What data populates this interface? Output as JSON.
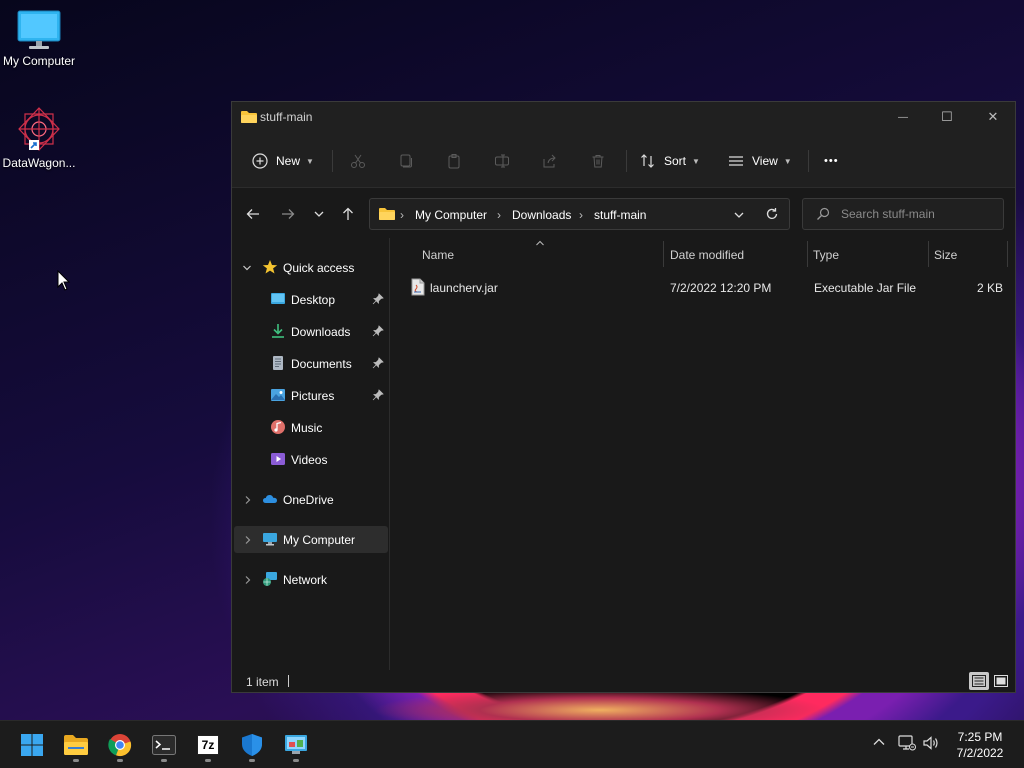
{
  "desktop": {
    "icons": [
      {
        "label": "My Computer"
      },
      {
        "label": "DataWagon..."
      }
    ]
  },
  "window": {
    "title": "stuff-main",
    "controls": {
      "minimize": "—",
      "maximize": "☐",
      "close": "✕"
    }
  },
  "toolbar": {
    "new_label": "New",
    "sort_label": "Sort",
    "view_label": "View",
    "more_label": "•••"
  },
  "address": {
    "crumbs": [
      "My Computer",
      "Downloads",
      "stuff-main"
    ],
    "search_placeholder": "Search stuff-main"
  },
  "sidebar": {
    "quick_access": "Quick access",
    "items": [
      {
        "label": "Desktop",
        "pinned": true
      },
      {
        "label": "Downloads",
        "pinned": true
      },
      {
        "label": "Documents",
        "pinned": true
      },
      {
        "label": "Pictures",
        "pinned": true
      },
      {
        "label": "Music",
        "pinned": false
      },
      {
        "label": "Videos",
        "pinned": false
      }
    ],
    "onedrive": "OneDrive",
    "my_computer": "My Computer",
    "network": "Network"
  },
  "list": {
    "columns": [
      "Name",
      "Date modified",
      "Type",
      "Size"
    ],
    "rows": [
      {
        "name": "launcherv.jar",
        "date": "7/2/2022 12:20 PM",
        "type": "Executable Jar File",
        "size": "2 KB"
      }
    ]
  },
  "status": {
    "count": "1 item"
  },
  "taskbar": {
    "time": "7:25 PM",
    "date": "7/2/2022",
    "seven_zip_label": "7z"
  },
  "colors": {
    "accent": "#4cc2ff",
    "folder": "#f8c43a",
    "window_bg": "#191919"
  }
}
